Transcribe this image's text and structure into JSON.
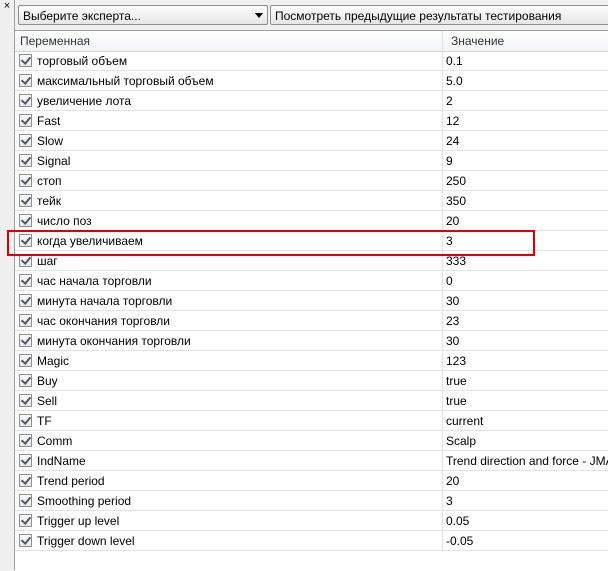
{
  "toolbar": {
    "close_glyph": "×",
    "expert_select": "Выберите эксперта...",
    "prev_results": "Посмотреть предыдущие результаты тестирования"
  },
  "grid": {
    "col_variable": "Переменная",
    "col_value": "Значение",
    "rows": [
      {
        "name": "торговый объем",
        "value": "0.1"
      },
      {
        "name": "максимальный торговый объем",
        "value": "5.0"
      },
      {
        "name": "увеличение лота",
        "value": "2"
      },
      {
        "name": "Fast",
        "value": "12"
      },
      {
        "name": "Slow",
        "value": "24"
      },
      {
        "name": "Signal",
        "value": "9"
      },
      {
        "name": "стоп",
        "value": "250"
      },
      {
        "name": "тейк",
        "value": "350"
      },
      {
        "name": "число поз",
        "value": "20"
      },
      {
        "name": "когда увеличиваем",
        "value": "3"
      },
      {
        "name": "шаг",
        "value": "333"
      },
      {
        "name": "час начала торговли",
        "value": "0"
      },
      {
        "name": "минута начала торговли",
        "value": "30"
      },
      {
        "name": "час окончания торговли",
        "value": "23"
      },
      {
        "name": "минута окончания торговли",
        "value": "30"
      },
      {
        "name": "Magic",
        "value": "123"
      },
      {
        "name": "Buy",
        "value": "true"
      },
      {
        "name": "Sell",
        "value": "true"
      },
      {
        "name": "TF",
        "value": "current"
      },
      {
        "name": "Comm",
        "value": "Scalp"
      },
      {
        "name": "IndName",
        "value": "Trend direction and force - JMA"
      },
      {
        "name": "Trend period",
        "value": "20"
      },
      {
        "name": "Smoothing period",
        "value": "3"
      },
      {
        "name": "Trigger up level",
        "value": "0.05"
      },
      {
        "name": "Trigger down level",
        "value": "-0.05"
      }
    ]
  },
  "highlight_color": "#e00000"
}
